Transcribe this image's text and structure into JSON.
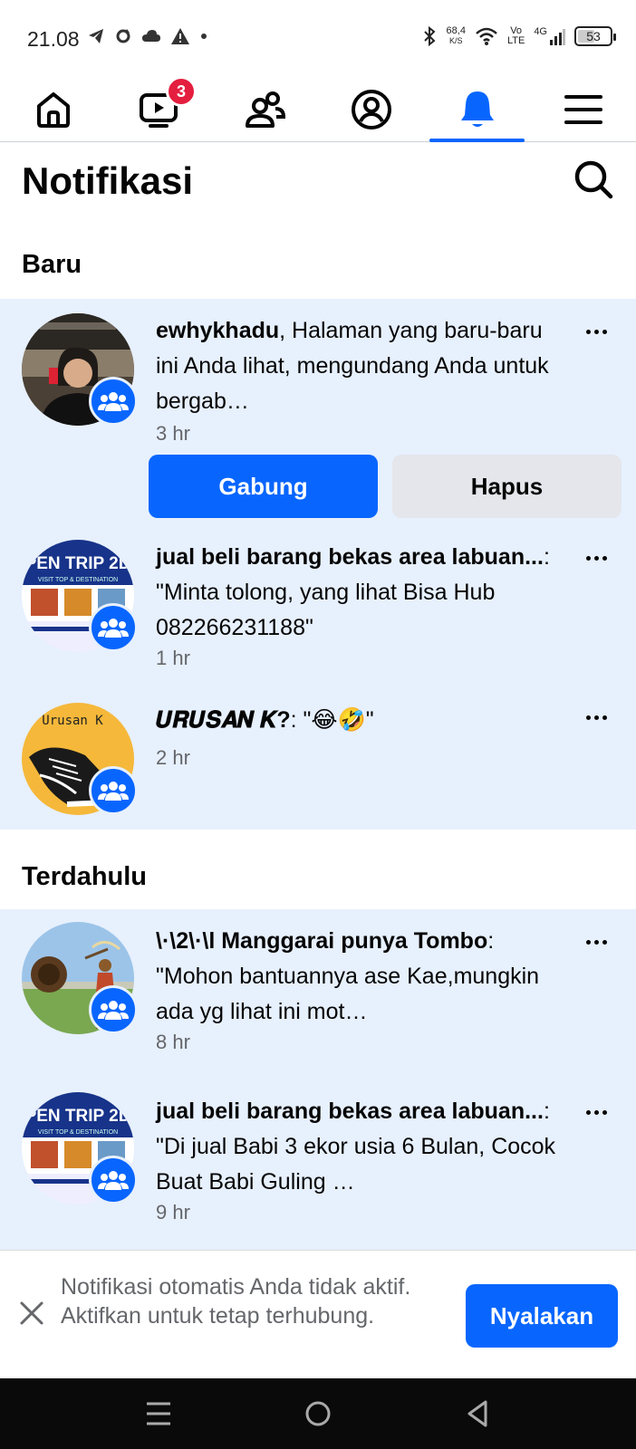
{
  "status_bar": {
    "time": "21.08",
    "net_speed_value": "68,4",
    "net_speed_unit": "K/S",
    "volte_top": "Vo",
    "volte_bottom": "LTE",
    "network": "4G",
    "battery": "53"
  },
  "nav": {
    "video_badge": "3",
    "active_tab": "notifications"
  },
  "header": {
    "title": "Notifikasi"
  },
  "sections": {
    "new_title": "Baru",
    "earlier_title": "Terdahulu"
  },
  "notifications_new": [
    {
      "actor": "ewhykhadu",
      "text": ", Halaman yang baru-baru ini Anda lihat, mengundang Anda untuk bergab…",
      "time": "3 hr",
      "primary_action": "Gabung",
      "secondary_action": "Hapus"
    },
    {
      "actor": "jual beli barang bekas area labuan...",
      "text": ": \"Minta tolong, yang lihat Bisa Hub 082266231188\"",
      "time": "1 hr"
    },
    {
      "actor": "𝑼𝑹𝑼𝑺𝑨𝑵 𝑲?",
      "text": ": \"😂🤣\"",
      "time": "2 hr"
    }
  ],
  "notifications_earlier": [
    {
      "actor": "\\·\\2\\·\\l Manggarai punya Tombo",
      "text": ": \"Mohon bantuannya ase Kae,mungkin ada yg lihat ini mot…",
      "time": "8 hr"
    },
    {
      "actor": "jual beli barang bekas area labuan...",
      "text": ": \"Di jual Babi 3 ekor usia 6 Bulan, Cocok Buat Babi Guling …",
      "time": "9 hr"
    }
  ],
  "avatar_text": {
    "open_trip": "PEN TRIP 2D",
    "open_trip_sub": "VISIT TOP & DESTINATION",
    "urusan": "Urusan K"
  },
  "banner": {
    "text": "Notifikasi otomatis Anda tidak aktif. Aktifkan untuk tetap terhubung.",
    "button": "Nyalakan"
  },
  "colors": {
    "accent": "#0866ff",
    "highlight_bg": "#e7f0fd",
    "badge": "#e41e3f"
  }
}
